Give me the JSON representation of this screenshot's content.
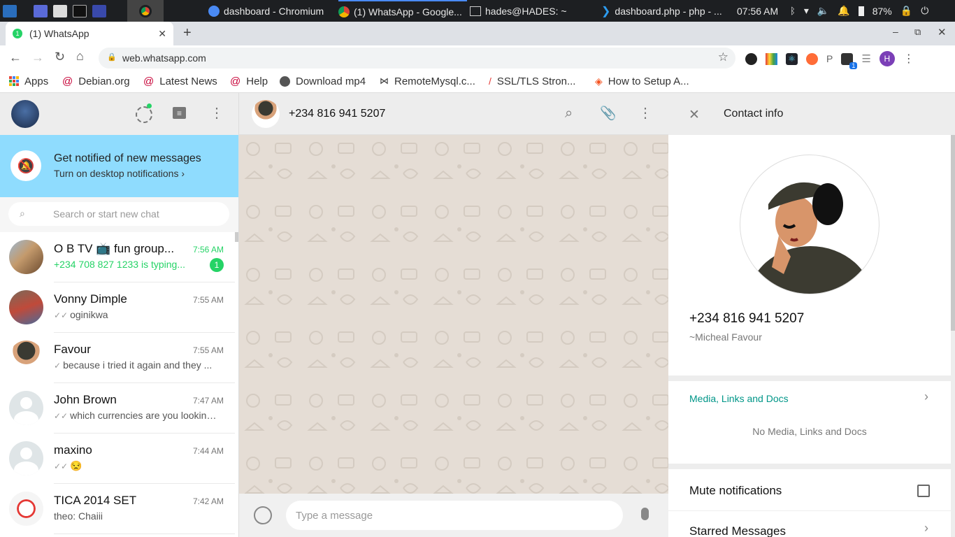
{
  "taskbar": {
    "tasks": [
      {
        "label": "dashboard - Chromium"
      },
      {
        "label": "(1) WhatsApp - Google..."
      },
      {
        "label": "hades@HADES: ~"
      },
      {
        "label": "dashboard.php - php - ..."
      }
    ],
    "clock": "07:56 AM",
    "battery": "87%"
  },
  "browser": {
    "tab_title": "(1) WhatsApp",
    "tab_badge": "1",
    "url": "web.whatsapp.com",
    "profile_initial": "H",
    "ext_badge": "1",
    "bookmarks": [
      {
        "label": "Apps"
      },
      {
        "label": "Debian.org"
      },
      {
        "label": "Latest News"
      },
      {
        "label": "Help"
      },
      {
        "label": "Download mp4"
      },
      {
        "label": "RemoteMysql.c..."
      },
      {
        "label": "SSL/TLS Stron..."
      },
      {
        "label": "How to Setup A..."
      }
    ]
  },
  "left": {
    "notification": {
      "title": "Get notified of new messages",
      "subtitle": "Turn on desktop notifications ›"
    },
    "search_placeholder": "Search or start new chat",
    "chats": [
      {
        "name": "O B TV 📺 fun group...",
        "time": "7:56 AM",
        "preview": "+234 708 827 1233 is typing...",
        "ticks": "",
        "unread": "1",
        "typing": true
      },
      {
        "name": "Vonny Dimple",
        "time": "7:55 AM",
        "preview": "oginikwa",
        "ticks": "✓✓",
        "unread": "",
        "typing": false
      },
      {
        "name": "Favour",
        "time": "7:55 AM",
        "preview": "because i tried it again and they ...",
        "ticks": "✓",
        "unread": "",
        "typing": false
      },
      {
        "name": "John Brown",
        "time": "7:47 AM",
        "preview": "which currencies are you looking...",
        "ticks": "✓✓",
        "unread": "",
        "typing": false
      },
      {
        "name": "maxino",
        "time": "7:44 AM",
        "preview": "😒",
        "ticks": "✓✓",
        "unread": "",
        "typing": false
      },
      {
        "name": "TICA 2014 SET",
        "time": "7:42 AM",
        "preview": "theo: Chaiii",
        "ticks": "",
        "unread": "",
        "typing": false
      }
    ]
  },
  "conversation": {
    "contact": "+234 816 941 5207",
    "compose_placeholder": "Type a message"
  },
  "contact_info": {
    "title": "Contact info",
    "phone": "+234 816 941 5207",
    "name": "~Micheal Favour",
    "media_label": "Media, Links and Docs",
    "media_empty": "No Media, Links and Docs",
    "mute_label": "Mute notifications",
    "starred_label": "Starred Messages"
  },
  "colors": {
    "accent_green": "#25d366",
    "teal": "#009688",
    "notif_bg": "#8fdcfe",
    "wallpaper": "#e5ddd5"
  }
}
